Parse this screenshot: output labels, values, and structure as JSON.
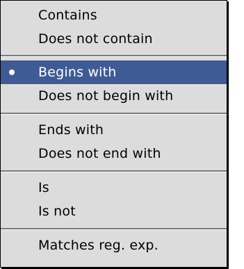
{
  "menu": {
    "items": [
      {
        "label": "Contains",
        "selected": false
      },
      {
        "label": "Does not contain",
        "selected": false
      },
      {
        "label": "Begins with",
        "selected": true,
        "mark": "bullet"
      },
      {
        "label": "Does not begin with",
        "selected": false
      },
      {
        "label": "Ends with",
        "selected": false
      },
      {
        "label": "Does not end with",
        "selected": false
      },
      {
        "label": "Is",
        "selected": false
      },
      {
        "label": "Is not",
        "selected": false
      },
      {
        "label": "Matches reg. exp.",
        "selected": false
      }
    ]
  },
  "colors": {
    "menu_background": "#dcdcdc",
    "highlight": "#3f5b95",
    "highlight_text": "#ffffff",
    "text": "#000000",
    "separator": "#7a7a7a"
  }
}
